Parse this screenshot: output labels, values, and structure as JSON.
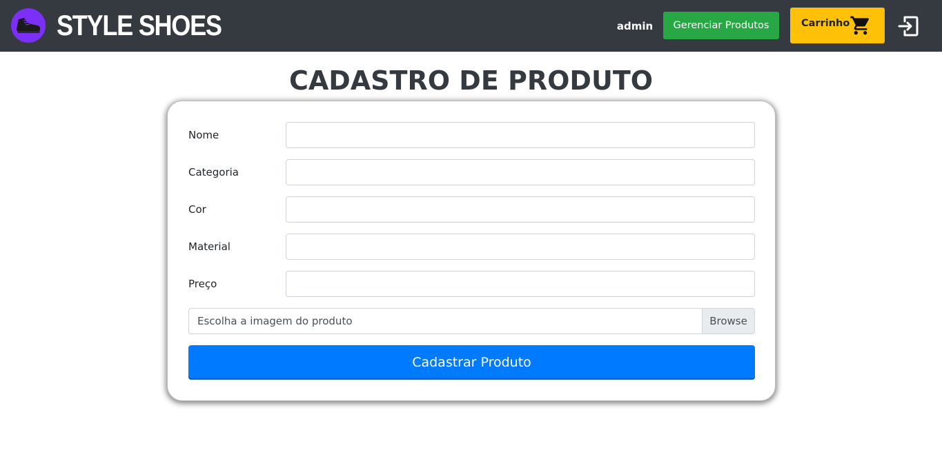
{
  "navbar": {
    "brand": "STYLE SHOES",
    "user": "admin",
    "manage_button": "Gerenciar Produtos",
    "cart_button": "Carrinho",
    "logo_icon": "sneaker-icon",
    "cart_icon": "shopping-cart-icon",
    "logout_icon": "logout-icon",
    "colors": {
      "bg": "#343a40",
      "logo_bg": "#7b2ff7",
      "manage": "#28a745",
      "cart": "#ffc107"
    }
  },
  "main": {
    "title": "CADASTRO DE PRODUTO",
    "fields": [
      {
        "label": "Nome",
        "value": ""
      },
      {
        "label": "Categoria",
        "value": ""
      },
      {
        "label": "Cor",
        "value": ""
      },
      {
        "label": "Material",
        "value": ""
      },
      {
        "label": "Preço",
        "value": ""
      }
    ],
    "file": {
      "placeholder": "Escolha a imagem do produto",
      "browse": "Browse"
    },
    "submit": "Cadastrar Produto",
    "colors": {
      "submit": "#007bff",
      "title": "#343a40"
    }
  }
}
